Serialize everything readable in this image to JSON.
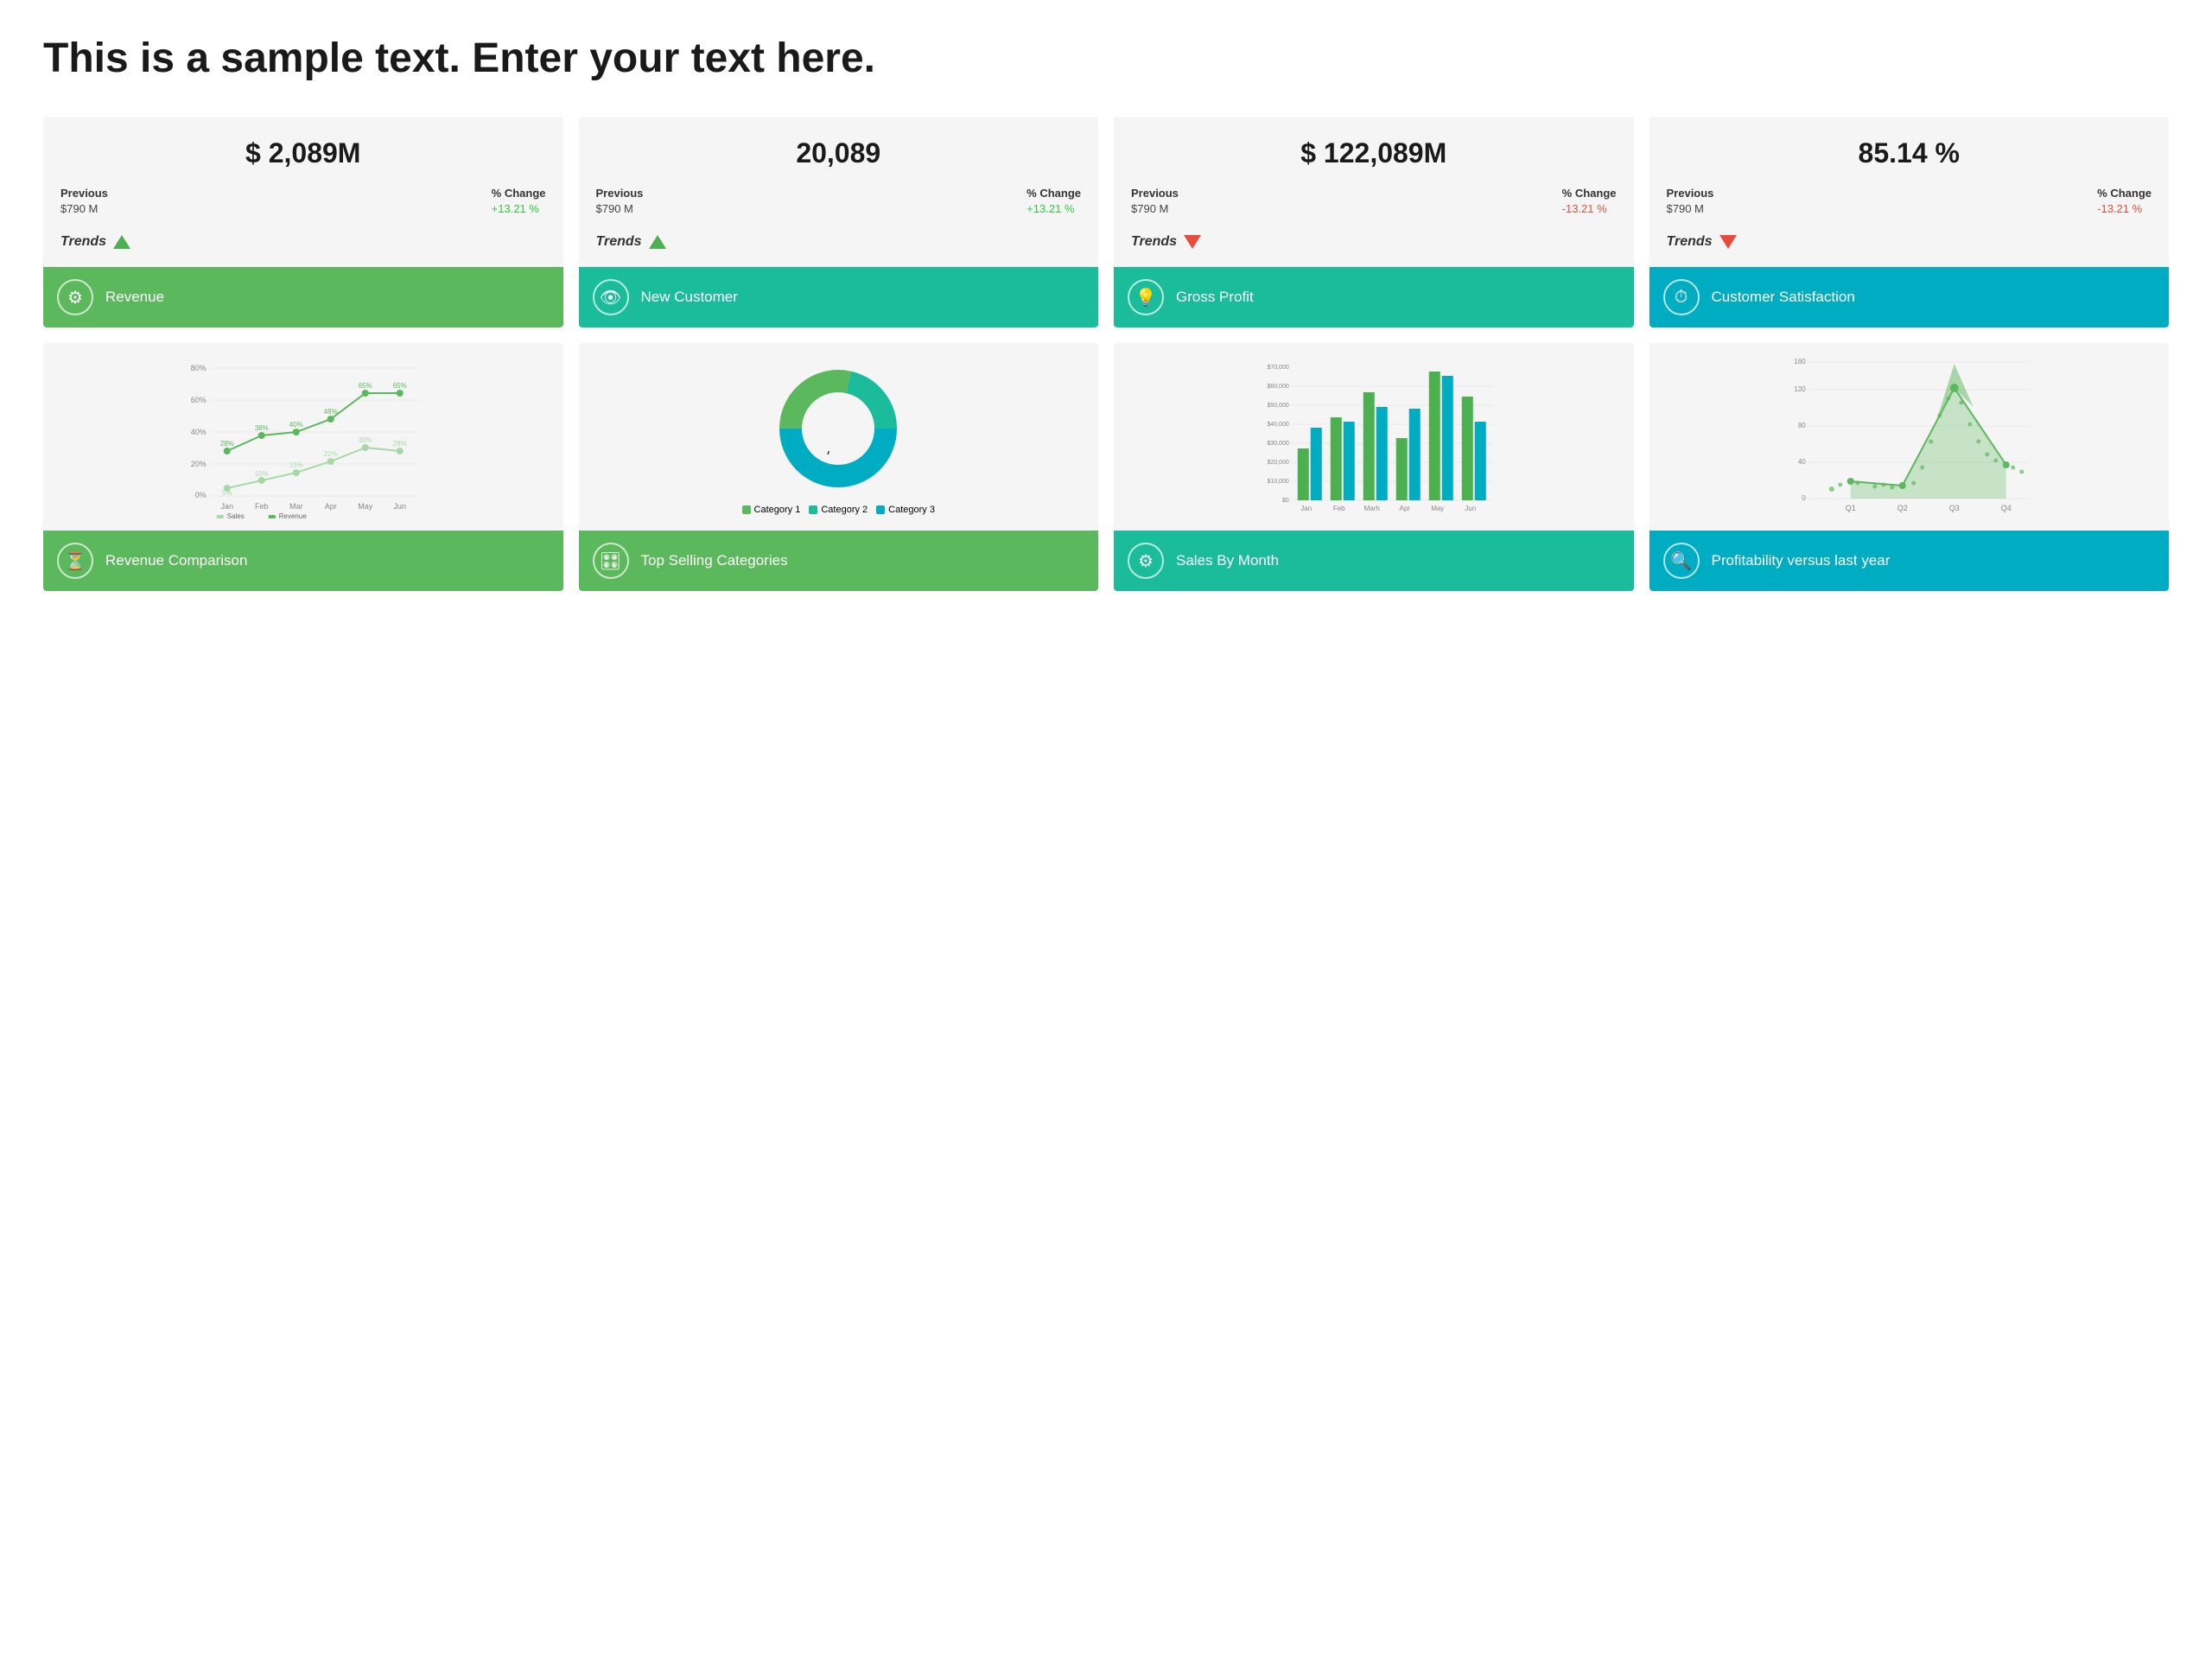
{
  "page": {
    "title": "This is a sample text. Enter your text here."
  },
  "kpi_cards": [
    {
      "id": "revenue",
      "main_value": "$ 2,089M",
      "previous_label": "Previous",
      "previous_value": "$790 M",
      "change_label": "% Change",
      "change_value": "+13.21 %",
      "change_positive": true,
      "trends_label": "Trends",
      "footer_label": "Revenue",
      "footer_color": "green",
      "icon": "⚙"
    },
    {
      "id": "new_customer",
      "main_value": "20,089",
      "previous_label": "Previous",
      "previous_value": "$790 M",
      "change_label": "% Change",
      "change_value": "+13.21 %",
      "change_positive": true,
      "trends_label": "Trends",
      "footer_label": "New Customer",
      "footer_color": "teal",
      "icon": "👁"
    },
    {
      "id": "gross_profit",
      "main_value": "$ 122,089M",
      "previous_label": "Previous",
      "previous_value": "$790 M",
      "change_label": "% Change",
      "change_value": "-13.21 %",
      "change_positive": false,
      "trends_label": "Trends",
      "footer_label": "Gross Profit",
      "footer_color": "teal",
      "icon": "💡"
    },
    {
      "id": "customer_satisfaction",
      "main_value": "85.14 %",
      "previous_label": "Previous",
      "previous_value": "$790 M",
      "change_label": "% Change",
      "change_value": "-13.21 %",
      "change_positive": false,
      "trends_label": "Trends",
      "footer_label": "Customer Satisfaction",
      "footer_color": "blue",
      "icon": "⏱"
    }
  ],
  "chart_cards": [
    {
      "id": "revenue_comparison",
      "footer_label": "Revenue Comparison",
      "footer_color": "green",
      "icon": "⏳",
      "chart_type": "line",
      "line_data": {
        "months": [
          "Jan",
          "Feb",
          "Mar",
          "Apr",
          "May",
          "Jun"
        ],
        "sales": [
          5,
          10,
          15,
          22,
          30,
          28
        ],
        "revenue": [
          28,
          38,
          40,
          48,
          65,
          65
        ],
        "y_labels": [
          "0%",
          "20%",
          "40%",
          "60%",
          "80%"
        ],
        "series": [
          "Sales",
          "Revenue"
        ]
      }
    },
    {
      "id": "top_selling_categories",
      "footer_label": "Top Selling Categories",
      "footer_color": "green",
      "icon": "🎛",
      "chart_type": "donut",
      "donut_data": {
        "segments": [
          {
            "label": "Category 1",
            "value": 4,
            "color": "#5cb85c"
          },
          {
            "label": "Category 2",
            "value": 3,
            "color": "#1abc9c"
          },
          {
            "label": "Category 3",
            "value": 7,
            "color": "#00acc1"
          }
        ]
      }
    },
    {
      "id": "sales_by_month",
      "footer_label": "Sales By Month",
      "footer_color": "teal",
      "icon": "⚙",
      "chart_type": "bar",
      "bar_data": {
        "months": [
          "Jan",
          "Feb",
          "Marh",
          "Apr",
          "May",
          "Jun"
        ],
        "series1": [
          25000,
          40000,
          52000,
          30000,
          62000,
          50000
        ],
        "series2": [
          35000,
          38000,
          45000,
          44000,
          60000,
          38000
        ],
        "y_labels": [
          "$0",
          "$10,000",
          "$20,000",
          "$30,000",
          "$40,000",
          "$50,000",
          "$60,000",
          "$70,000"
        ],
        "colors": [
          "#4caf50",
          "#00acc1"
        ]
      }
    },
    {
      "id": "profitability",
      "footer_label": "Profitability versus last year",
      "footer_color": "blue",
      "icon": "🔍",
      "chart_type": "area",
      "area_data": {
        "quarters": [
          "Q1",
          "Q2",
          "Q3",
          "Q4"
        ],
        "values": [
          20,
          15,
          130,
          40
        ],
        "y_labels": [
          "0",
          "40",
          "80",
          "120",
          "160"
        ],
        "color": "#5cb85c"
      }
    }
  ]
}
